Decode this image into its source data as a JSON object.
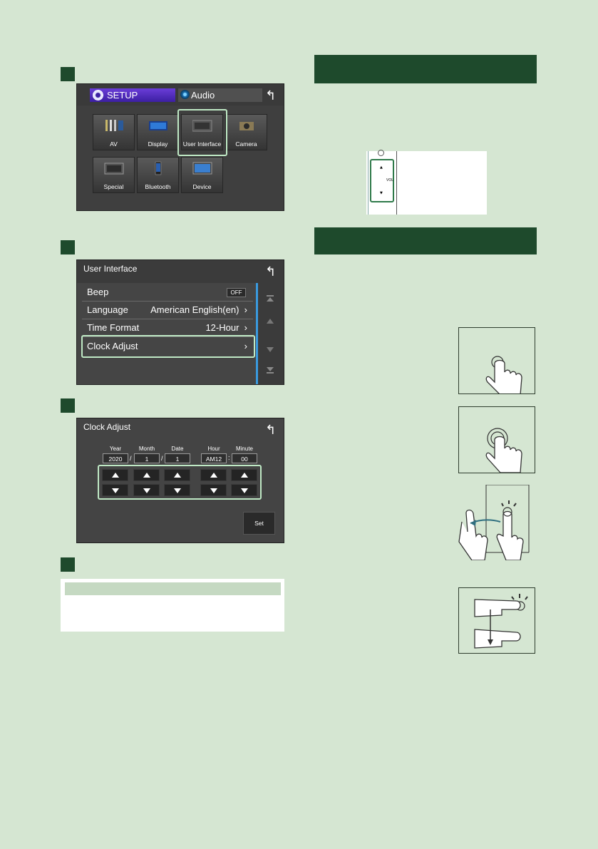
{
  "setup_screen": {
    "tab_setup": "SETUP",
    "tab_audio": "Audio",
    "back_icon": "back-arrow-icon",
    "tiles": [
      {
        "label": "AV"
      },
      {
        "label": "Display"
      },
      {
        "label": "User Interface"
      },
      {
        "label": "Camera"
      },
      {
        "label": "Special"
      },
      {
        "label": "Bluetooth"
      },
      {
        "label": "Device"
      }
    ]
  },
  "user_interface_screen": {
    "title": "User Interface",
    "rows": [
      {
        "label": "Beep",
        "value": "OFF"
      },
      {
        "label": "Language",
        "value": "American English(en)",
        "chevron": "›"
      },
      {
        "label": "Time Format",
        "value": "12-Hour",
        "chevron": "›"
      },
      {
        "label": "Clock Adjust",
        "value": "",
        "chevron": "›"
      }
    ]
  },
  "clock_adjust_screen": {
    "title": "Clock Adjust",
    "fields": [
      {
        "label": "Year",
        "value": "2020"
      },
      {
        "label": "Month",
        "value": "1"
      },
      {
        "label": "Date",
        "value": "1"
      },
      {
        "label": "Hour",
        "value": "AM12"
      },
      {
        "label": "Minute",
        "value": "00"
      }
    ],
    "separators": {
      "slash": "/",
      "colon": ":"
    },
    "set_label": "Set"
  },
  "knob_panel": {
    "vol_label": "VOL",
    "up_symbol": "▲",
    "down_symbol": "▼"
  },
  "colors": {
    "page_bg": "#d5e6d2",
    "section_band": "#1e4a2c",
    "highlight": "#bfe9c5"
  }
}
